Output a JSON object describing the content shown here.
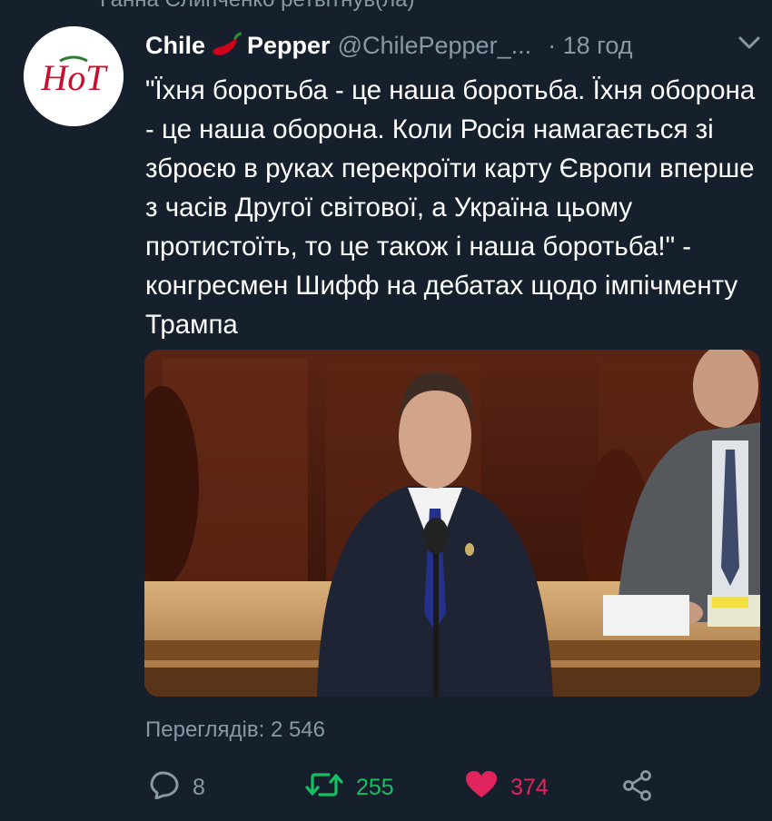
{
  "context_line": "Ганна Слипченко ретвітнув(ла)",
  "tweet": {
    "author_name_part1": "Chile",
    "author_name_part2": "Pepper",
    "handle": "@ChilePepper_...",
    "time": "· 18 год",
    "avatar_text": "HoT",
    "text": "\"Їхня боротьба - це наша боротьба. Їхня оборона - це наша оборона. Коли Росія намагається зі зброєю в руках перекроїти карту Європи вперше з часів Другої світової, а Україна цьому протистоїть, то це також і наша боротьба!\" - конгресмен Шифф на дебатах щодо імпічменту Трампа",
    "views": "Переглядів: 2 546"
  },
  "actions": {
    "replies": "8",
    "retweets": "255",
    "likes": "374"
  },
  "colors": {
    "background": "#16202c",
    "secondary_text": "#8899a6",
    "retweet_green": "#17bf63",
    "like_pink": "#e0245e",
    "avatar_red": "#c8102e"
  },
  "icons": [
    "reply-icon",
    "retweet-icon",
    "heart-icon",
    "share-icon",
    "chevron-down-icon",
    "chili-pepper-icon"
  ]
}
